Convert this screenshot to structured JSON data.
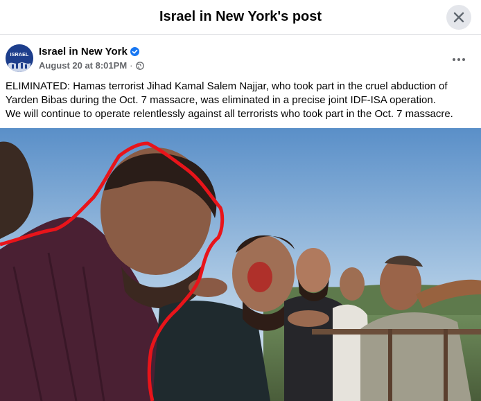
{
  "dialog": {
    "title": "Israel in New York's post"
  },
  "post": {
    "page_name": "Israel in New York",
    "avatar_label": "ISRAEL",
    "timestamp": "August 20 at 8:01PM",
    "separator": "·",
    "verified": true,
    "text_line_1": "ELIMINATED: Hamas terrorist Jihad Kamal Salem Najjar, who took part in the cruel abduction of Yarden Bibas during the Oct. 7 massacre, was eliminated in a precise joint IDF-ISA operation.",
    "text_line_2": "We will continue to operate relentlessly against all terrorists who took part in the Oct. 7 massacre."
  },
  "colors": {
    "accent_blue": "#1877f2",
    "highlight_red": "#e8141a"
  },
  "icons": {
    "close": "close-icon",
    "verified": "verified-badge-icon",
    "audience": "globe-icon",
    "more": "more-options-icon"
  }
}
